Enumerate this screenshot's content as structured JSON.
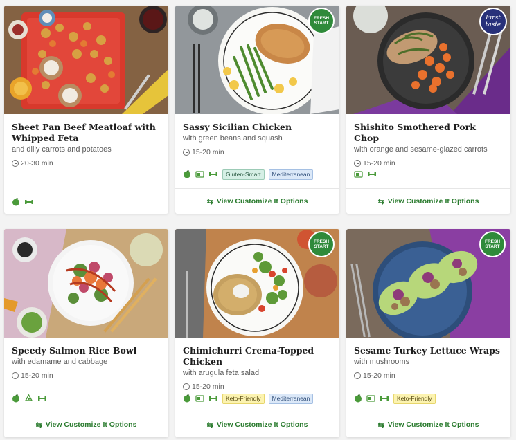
{
  "cta_label": "View Customize It Options",
  "cards": [
    {
      "title": "Sheet Pan Beef Meatloaf with Whipped Feta",
      "subtitle": "and dilly carrots and potatoes",
      "time": "20-30 min",
      "icons": [
        "leaf-icon",
        "protein-icon"
      ],
      "tags": [],
      "badge": null,
      "has_cta": false
    },
    {
      "title": "Sassy Sicilian Chicken",
      "subtitle": "with green beans and squash",
      "time": "15-20 min",
      "icons": [
        "leaf-icon",
        "calorie-icon",
        "protein-icon"
      ],
      "tags": [
        "Gluten-Smart",
        "Mediterranean"
      ],
      "badge": "FRESH START",
      "has_cta": true
    },
    {
      "title": "Shishito Smothered Pork Chop",
      "subtitle": "with orange and sesame-glazed carrots",
      "time": "15-20 min",
      "icons": [
        "calorie-icon",
        "protein-icon"
      ],
      "tags": [],
      "badge": "First taste",
      "has_cta": true
    },
    {
      "title": "Speedy Salmon Rice Bowl",
      "subtitle": "with edamame and cabbage",
      "time": "15-20 min",
      "icons": [
        "leaf-icon",
        "recycle-icon",
        "protein-icon"
      ],
      "tags": [],
      "badge": null,
      "has_cta": true
    },
    {
      "title": "Chimichurri Crema-Topped Chicken",
      "subtitle": "with arugula feta salad",
      "time": "15-20 min",
      "icons": [
        "leaf-icon",
        "calorie-icon",
        "protein-icon"
      ],
      "tags": [
        "Keto-Friendly",
        "Mediterranean"
      ],
      "badge": "FRESH START",
      "has_cta": true
    },
    {
      "title": "Sesame Turkey Lettuce Wraps",
      "subtitle": "with mushrooms",
      "time": "15-20 min",
      "icons": [
        "leaf-icon",
        "calorie-icon",
        "protein-icon"
      ],
      "tags": [
        "Keto-Friendly"
      ],
      "badge": "FRESH START",
      "has_cta": true
    }
  ],
  "colors": {
    "accent_green": "#2a7b2e",
    "fresh_badge": "#2f8a3a",
    "first_taste_badge": "#28317a"
  }
}
